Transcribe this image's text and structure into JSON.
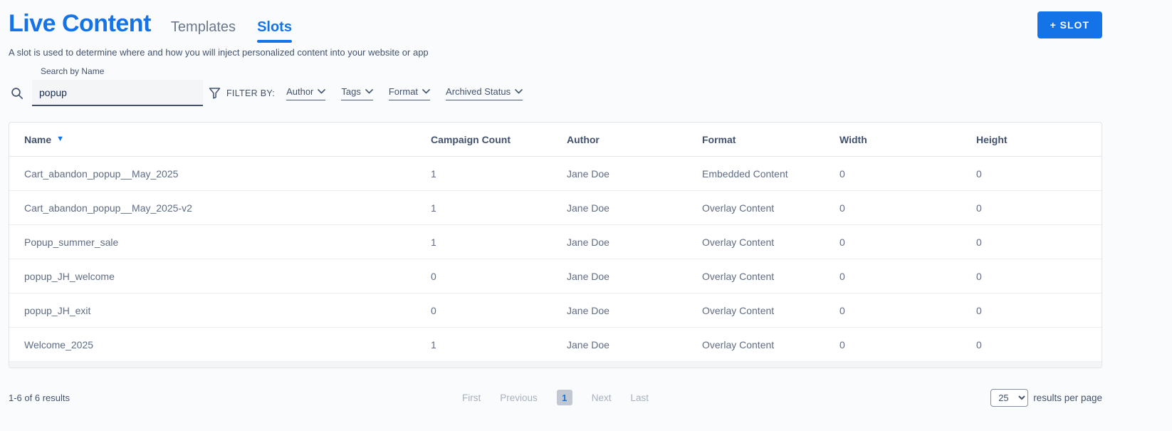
{
  "header": {
    "title": "Live Content",
    "tabs": [
      {
        "label": "Templates",
        "active": false
      },
      {
        "label": "Slots",
        "active": true
      }
    ],
    "slot_button_label": "+ SLOT",
    "subtitle": "A slot is used to determine where and how you will inject personalized content into your website or app"
  },
  "search": {
    "label": "Search by Name",
    "value": "popup",
    "filter_by_label": "FILTER BY:",
    "filters": [
      {
        "label": "Author"
      },
      {
        "label": "Tags"
      },
      {
        "label": "Format"
      },
      {
        "label": "Archived Status"
      }
    ]
  },
  "table": {
    "columns": [
      "Name",
      "Campaign Count",
      "Author",
      "Format",
      "Width",
      "Height"
    ],
    "sorted_column": "Name",
    "sort_direction": "descending",
    "sort_arrow": "▼",
    "rows": [
      {
        "name": "Cart_abandon_popup__May_2025",
        "campaign_count": "1",
        "author": "Jane Doe",
        "format": "Embedded Content",
        "width": "0",
        "height": "0"
      },
      {
        "name": "Cart_abandon_popup__May_2025-v2",
        "campaign_count": "1",
        "author": "Jane Doe",
        "format": "Overlay Content",
        "width": "0",
        "height": "0"
      },
      {
        "name": "Popup_summer_sale",
        "campaign_count": "1",
        "author": "Jane Doe",
        "format": "Overlay Content",
        "width": "0",
        "height": "0"
      },
      {
        "name": "popup_JH_welcome",
        "campaign_count": "0",
        "author": "Jane Doe",
        "format": "Overlay Content",
        "width": "0",
        "height": "0"
      },
      {
        "name": "popup_JH_exit",
        "campaign_count": "0",
        "author": "Jane Doe",
        "format": "Overlay Content",
        "width": "0",
        "height": "0"
      },
      {
        "name": "Welcome_2025",
        "campaign_count": "1",
        "author": "Jane Doe",
        "format": "Overlay Content",
        "width": "0",
        "height": "0"
      }
    ]
  },
  "pagination": {
    "summary": "1-6 of 6 results",
    "first_label": "First",
    "previous_label": "Previous",
    "current_page": "1",
    "next_label": "Next",
    "last_label": "Last",
    "per_page": "25",
    "per_page_suffix": "results per page"
  },
  "colors": {
    "accent_blue": "#1473E6",
    "heading_text": "#42526E",
    "cell_text": "#5E6C84",
    "disabled_text": "#A8B0BF",
    "page_background": "#FAFBFC",
    "border": "#E1E5EA"
  }
}
